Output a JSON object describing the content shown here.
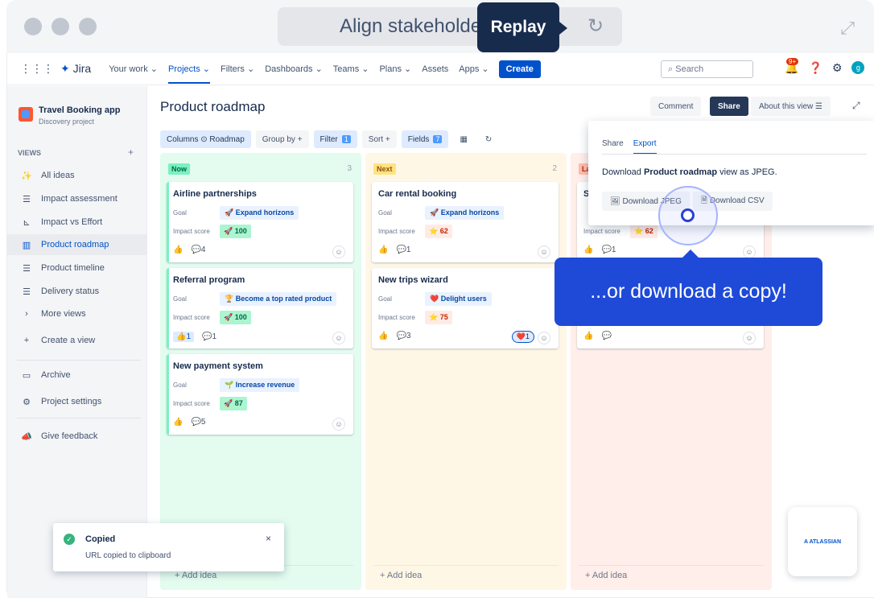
{
  "browser": {
    "address_text": "Align stakeholders",
    "replay_label": "Replay",
    "reload_icon": "↻",
    "expand_icon": "⤢"
  },
  "topnav": {
    "logo": "Jira",
    "items": [
      "Your work ⌄",
      "Projects ⌄",
      "Filters ⌄",
      "Dashboards ⌄",
      "Teams ⌄",
      "Plans ⌄",
      "Assets",
      "Apps ⌄"
    ],
    "create_label": "Create",
    "search_placeholder": "Search",
    "notification_badge": "9+",
    "avatar_initial": "g"
  },
  "sidebar": {
    "project_name": "Travel Booking app",
    "project_type": "Discovery project",
    "views_heading": "VIEWS",
    "views_plus": "+",
    "items": [
      {
        "icon": "✨",
        "label": "All ideas"
      },
      {
        "icon": "☰",
        "label": "Impact assessment"
      },
      {
        "icon": "⊾",
        "label": "Impact vs Effort"
      },
      {
        "icon": "▥",
        "label": "Product roadmap"
      },
      {
        "icon": "☰",
        "label": "Product timeline"
      },
      {
        "icon": "☰",
        "label": "Delivery status"
      },
      {
        "icon": "›",
        "label": "More views"
      },
      {
        "icon": "+",
        "label": "Create a view"
      },
      {
        "icon": "▭",
        "label": "Archive"
      },
      {
        "icon": "⚙",
        "label": "Project settings"
      },
      {
        "icon": "📣",
        "label": "Give feedback"
      }
    ]
  },
  "main": {
    "title": "Product roadmap",
    "comment_label": "Comment",
    "share_label": "Share",
    "about_label": "About this view ☰",
    "toolbar": {
      "columns_label": "Columns ⊙ Roadmap",
      "groupby_label": "Group by  +",
      "filter_label": "Filter",
      "filter_count": "1",
      "sort_label": "Sort  +",
      "fields_label": "Fields",
      "fields_count": "7"
    }
  },
  "columns": [
    {
      "name": "Now",
      "count": "3",
      "add_idea": "+ Add idea",
      "cards": [
        {
          "title": "Airline partnerships",
          "goal_label": "Goal",
          "goal": "🚀 Expand horizons",
          "score_label": "Impact score",
          "score": "🚀 100",
          "likes": "👍",
          "comments": "💬4"
        },
        {
          "title": "Referral program",
          "goal_label": "Goal",
          "goal": "🏆 Become a top rated product",
          "score_label": "Impact score",
          "score": "🚀 100",
          "likes": "👍1",
          "comments": "💬1"
        },
        {
          "title": "New payment system",
          "goal_label": "Goal",
          "goal": "🌱 Increase revenue",
          "score_label": "Impact score",
          "score": "🚀 87",
          "likes": "👍",
          "comments": "💬5"
        }
      ]
    },
    {
      "name": "Next",
      "count": "2",
      "add_idea": "+ Add idea",
      "cards": [
        {
          "title": "Car rental booking",
          "goal_label": "Goal",
          "goal": "🚀 Expand horizons",
          "score_label": "Impact score",
          "score": "⭐ 62",
          "likes": "👍",
          "comments": "💬1"
        },
        {
          "title": "New trips wizard",
          "goal_label": "Goal",
          "goal": "❤️ Delight users",
          "score_label": "Impact score",
          "score": "⭐ 75",
          "likes": "👍",
          "comments": "💬3",
          "reaction": "❤️1"
        }
      ]
    },
    {
      "name": "La",
      "count": "",
      "add_idea": "+ Add idea",
      "cards": [
        {
          "title": "S",
          "goal_label": "",
          "goal": "",
          "score_label": "Impact score",
          "score": "⭐ 62",
          "likes": "👍",
          "comments": "💬1"
        },
        {
          "title": "",
          "goal_label": "",
          "goal": "",
          "score_label": "",
          "score": "",
          "likes": "👍",
          "comments": "💬"
        }
      ]
    }
  ],
  "popover": {
    "tab_share": "Share",
    "tab_export": "Export",
    "text_pre": "Download ",
    "text_bold": "Product roadmap",
    "text_post": " view as JPEG.",
    "btn_jpeg": "🖼 Download JPEG",
    "btn_csv": "🗎 Download CSV"
  },
  "tooltip": "...or download a copy!",
  "toast": {
    "title": "Copied",
    "message": "URL copied to clipboard",
    "close": "×"
  },
  "atlassian": "A ATLASSIAN"
}
